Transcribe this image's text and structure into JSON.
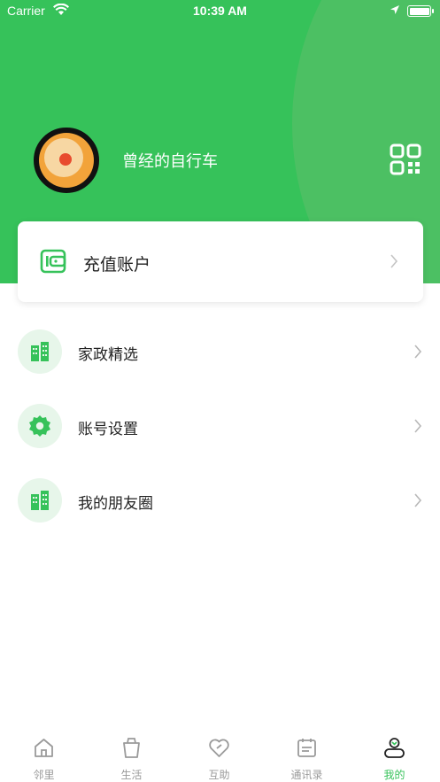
{
  "status_bar": {
    "carrier": "Carrier",
    "time": "10:39 AM"
  },
  "profile": {
    "username": "曾经的自行车"
  },
  "recharge": {
    "label": "充值账户"
  },
  "menu": [
    {
      "label": "家政精选",
      "icon": "building-icon"
    },
    {
      "label": "账号设置",
      "icon": "gear-icon"
    },
    {
      "label": "我的朋友圈",
      "icon": "building-icon"
    }
  ],
  "tabs": [
    {
      "label": "邻里",
      "icon": "home-icon"
    },
    {
      "label": "生活",
      "icon": "cup-icon"
    },
    {
      "label": "互助",
      "icon": "heart-icon"
    },
    {
      "label": "通讯录",
      "icon": "calendar-icon"
    },
    {
      "label": "我的",
      "icon": "user-icon",
      "active": true
    }
  ],
  "colors": {
    "accent": "#36c25a",
    "accent_light": "#e7f6ea",
    "tab_inactive": "#9a9a9a"
  }
}
